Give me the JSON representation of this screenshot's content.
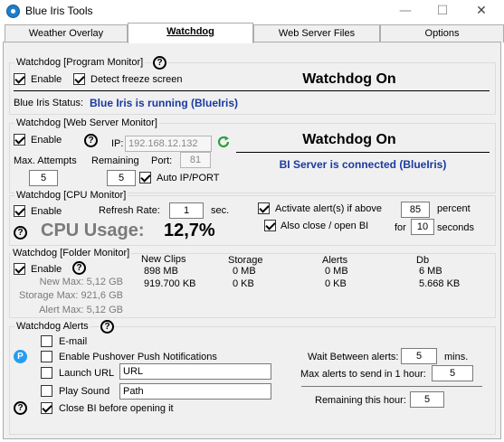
{
  "window": {
    "title": "Blue Iris Tools",
    "minimize": "—",
    "maximize": "☐",
    "close": "✕"
  },
  "tabs": [
    {
      "label": "Weather Overlay"
    },
    {
      "label": "Watchdog"
    },
    {
      "label": "Web Server Files"
    },
    {
      "label": "Options"
    }
  ],
  "program_monitor": {
    "title": "Watchdog [Program Monitor]",
    "enable_label": "Enable",
    "enable_checked": true,
    "freeze_label": "Detect freeze screen",
    "freeze_checked": true,
    "status_heading": "Watchdog On",
    "status_label": "Blue Iris Status:",
    "status_value": "Blue Iris is running (BlueIris)"
  },
  "web_monitor": {
    "title": "Watchdog [Web Server Monitor]",
    "enable_label": "Enable",
    "enable_checked": true,
    "ip_label": "IP:",
    "ip_value": "192.168.12.132",
    "max_attempts_label": "Max. Attempts",
    "max_attempts_value": "5",
    "remaining_label": "Remaining",
    "remaining_value": "5",
    "port_label": "Port:",
    "port_value": "81",
    "auto_label": "Auto IP/PORT",
    "auto_checked": true,
    "status_heading": "Watchdog On",
    "status_value": "BI Server is connected (BlueIris)"
  },
  "cpu_monitor": {
    "title": "Watchdog [CPU Monitor]",
    "enable_label": "Enable",
    "enable_checked": true,
    "refresh_label": "Refresh Rate:",
    "refresh_value": "1",
    "sec_label": "sec.",
    "usage_label": "CPU Usage:",
    "usage_value": "12,7%",
    "activate_label": "Activate alert(s) if above",
    "activate_checked": true,
    "activate_value": "85",
    "percent_label": "percent",
    "close_label": "Also close / open BI",
    "close_checked": true,
    "for_label": "for",
    "for_value": "10",
    "seconds_label": "seconds"
  },
  "folder_monitor": {
    "title": "Watchdog [Folder Monitor]",
    "enable_label": "Enable",
    "enable_checked": true,
    "new_max": "New Max: 5,12 GB",
    "storage_max": "Storage Max: 921,6 GB",
    "alert_max": "Alert Max: 5,12 GB",
    "columns": [
      {
        "header": "New Clips",
        "v1": "898 MB",
        "v2": "919.700 KB"
      },
      {
        "header": "Storage",
        "v1": "0 MB",
        "v2": "0 KB"
      },
      {
        "header": "Alerts",
        "v1": "0 MB",
        "v2": "0 KB"
      },
      {
        "header": "Db",
        "v1": "6 MB",
        "v2": "5.668 KB"
      }
    ]
  },
  "alerts": {
    "title": "Watchdog Alerts",
    "email_label": "E-mail",
    "email_checked": false,
    "pushover_label": "Enable Pushover Push Notifications",
    "pushover_checked": false,
    "launch_label": "Launch URL",
    "launch_checked": false,
    "url_value": "URL",
    "sound_label": "Play Sound",
    "sound_checked": false,
    "path_value": "Path",
    "closebi_label": "Close BI before opening it",
    "closebi_checked": true,
    "wait_label": "Wait Between alerts:",
    "wait_value": "5",
    "mins_label": "mins.",
    "max_label": "Max alerts to send in 1 hour:",
    "max_value": "5",
    "remaining_label": "Remaining this hour:",
    "remaining_value": "5"
  },
  "icons": {
    "help": "?",
    "pushover": "P"
  }
}
